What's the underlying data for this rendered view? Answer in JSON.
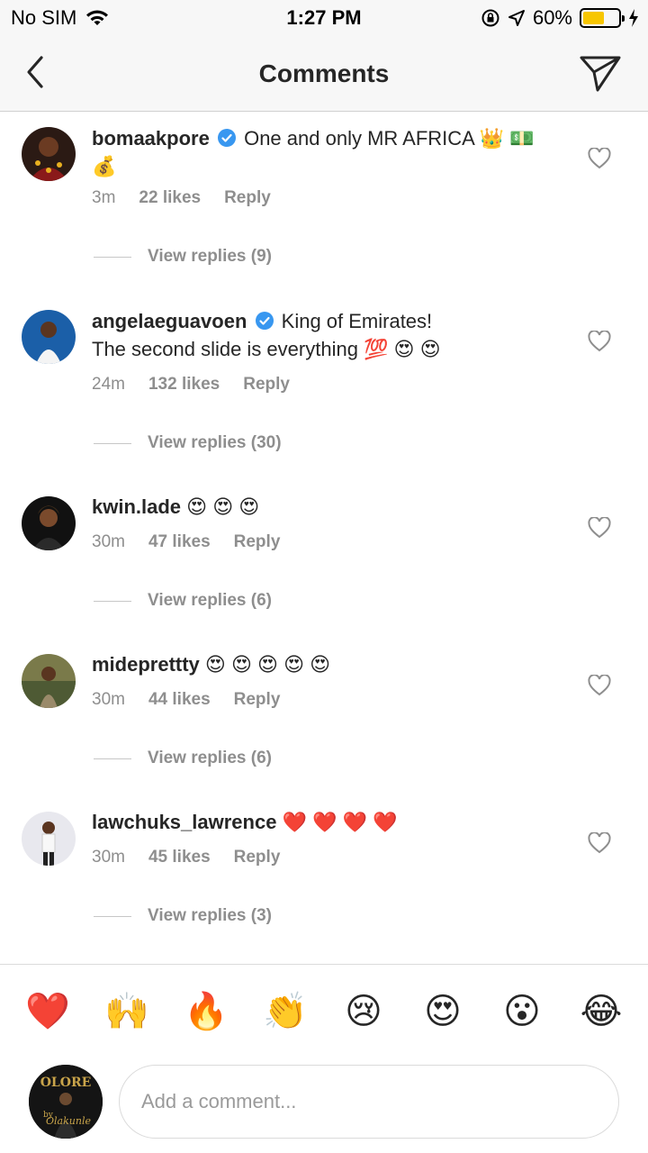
{
  "status": {
    "carrier": "No SIM",
    "time": "1:27 PM",
    "battery": "60%",
    "battery_level": 0.6
  },
  "header": {
    "title": "Comments"
  },
  "comments": [
    {
      "username": "bomaakpore",
      "verified": true,
      "text": "One and only MR AFRICA 👑 💵 💰",
      "time": "3m",
      "likes": "22 likes",
      "reply": "Reply",
      "view_replies": "View replies (9)"
    },
    {
      "username": "angelaeguavoen",
      "verified": true,
      "text": "King of Emirates!",
      "text2": "The second slide is everything 💯 😍 😍",
      "time": "24m",
      "likes": "132 likes",
      "reply": "Reply",
      "view_replies": "View replies (30)"
    },
    {
      "username": "kwin.lade",
      "verified": false,
      "text": "😍 😍 😍",
      "time": "30m",
      "likes": "47 likes",
      "reply": "Reply",
      "view_replies": "View replies (6)"
    },
    {
      "username": "mideprettty",
      "verified": false,
      "text": "😍 😍 😍 😍 😍",
      "time": "30m",
      "likes": "44 likes",
      "reply": "Reply",
      "view_replies": "View replies (6)"
    },
    {
      "username": "lawchuks_lawrence",
      "verified": false,
      "text": "❤️ ❤️ ❤️ ❤️",
      "time": "30m",
      "likes": "45 likes",
      "reply": "Reply",
      "view_replies": "View replies (3)"
    }
  ],
  "reactions": [
    "❤️",
    "🙌",
    "🔥",
    "👏",
    "😢",
    "😍",
    "😮",
    "😂"
  ],
  "composer": {
    "placeholder": "Add a comment...",
    "avatar_text": "OLORE",
    "avatar_sub": "by",
    "avatar_sig": "Olakunle"
  },
  "colors": {
    "verified": "#3897f0",
    "muted": "#8e8e8e",
    "battery": "#f7c600"
  }
}
